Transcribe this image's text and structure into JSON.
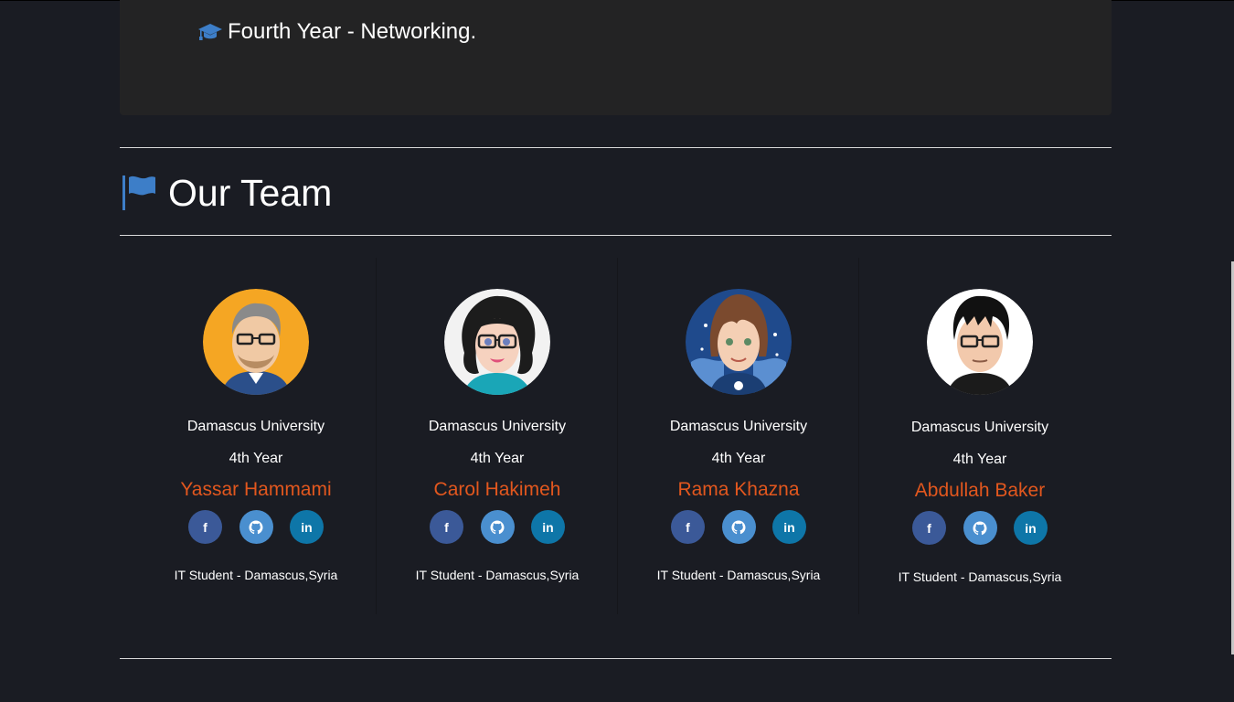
{
  "education": {
    "year_line": "Fourth Year - Networking.",
    "icon": "graduation-cap-icon"
  },
  "team": {
    "heading": "Our Team",
    "icon": "flag-icon",
    "members": [
      {
        "university": "Damascus University",
        "year": "4th Year",
        "name": "Yassar Hammami",
        "description": "IT Student - Damascus,Syria",
        "avatar": "avatar-man-glasses-orange"
      },
      {
        "university": "Damascus University",
        "year": "4th Year",
        "name": "Carol Hakimeh",
        "description": "IT Student - Damascus,Syria",
        "avatar": "avatar-woman-glasses-white"
      },
      {
        "university": "Damascus University",
        "year": "4th Year",
        "name": "Rama Khazna",
        "description": "IT Student - Damascus,Syria",
        "avatar": "avatar-girl-blue-night"
      },
      {
        "university": "Damascus University",
        "year": "4th Year",
        "name": "Abdullah Baker",
        "description": "IT Student - Damascus,Syria",
        "avatar": "avatar-man-glasses-white"
      }
    ],
    "social_icons": [
      "facebook-icon",
      "github-icon",
      "linkedin-icon"
    ]
  },
  "colors": {
    "background": "#1a1c23",
    "panel": "#232324",
    "accent_name": "#e2571e",
    "icon_blue": "#3d7ec8",
    "facebook": "#3b5998",
    "github": "#4a8fcf",
    "linkedin": "#0e76a8"
  }
}
